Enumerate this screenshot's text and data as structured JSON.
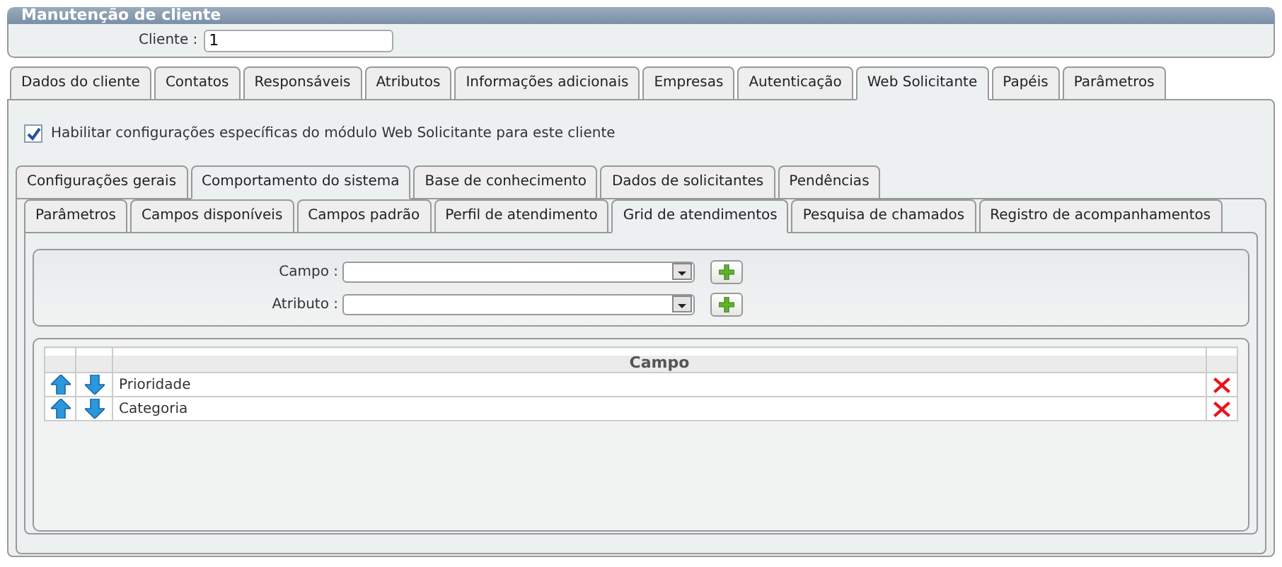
{
  "window": {
    "title": "Manutenção de cliente"
  },
  "client_field": {
    "label": "Cliente :",
    "value": "1"
  },
  "tabs": [
    {
      "label": "Dados do cliente",
      "selected": false
    },
    {
      "label": "Contatos",
      "selected": false
    },
    {
      "label": "Responsáveis",
      "selected": false
    },
    {
      "label": "Atributos",
      "selected": false
    },
    {
      "label": "Informações adicionais",
      "selected": false
    },
    {
      "label": "Empresas",
      "selected": false
    },
    {
      "label": "Autenticação",
      "selected": false
    },
    {
      "label": "Web Solicitante",
      "selected": true
    },
    {
      "label": "Papéis",
      "selected": false
    },
    {
      "label": "Parâmetros",
      "selected": false
    }
  ],
  "enable_checkbox": {
    "label": "Habilitar configurações específicas do módulo Web Solicitante para este cliente",
    "checked": true
  },
  "subtabs": [
    {
      "label": "Configurações gerais",
      "selected": false
    },
    {
      "label": "Comportamento do sistema",
      "selected": true
    },
    {
      "label": "Base de conhecimento",
      "selected": false
    },
    {
      "label": "Dados de solicitantes",
      "selected": false
    },
    {
      "label": "Pendências",
      "selected": false
    }
  ],
  "inner_tabs": [
    {
      "label": "Parâmetros",
      "selected": false
    },
    {
      "label": "Campos disponíveis",
      "selected": false
    },
    {
      "label": "Campos padrão",
      "selected": false
    },
    {
      "label": "Perfil de atendimento",
      "selected": false
    },
    {
      "label": "Grid de atendimentos",
      "selected": true
    },
    {
      "label": "Pesquisa de chamados",
      "selected": false
    },
    {
      "label": "Registro de acompanhamentos",
      "selected": false
    }
  ],
  "selects": [
    {
      "label": "Campo :"
    },
    {
      "label": "Atributo :"
    }
  ],
  "table": {
    "columns": [
      "Campo"
    ],
    "rows": [
      {
        "campo": "Prioridade"
      },
      {
        "campo": "Categoria"
      }
    ]
  }
}
